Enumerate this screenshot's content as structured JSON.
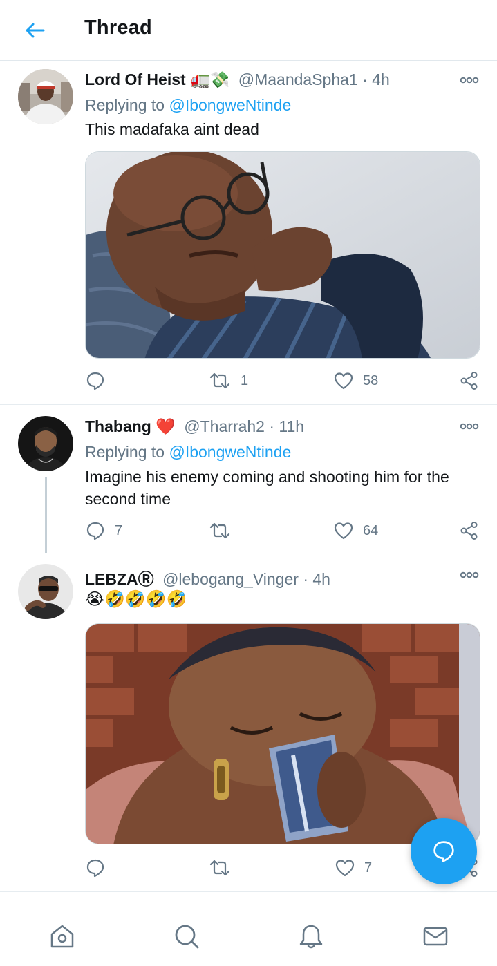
{
  "header": {
    "title": "Thread"
  },
  "tweets": [
    {
      "name": "Lord Of Heist",
      "name_emoji": "🚛💸",
      "handle": "@MaandaSpha1",
      "separator": "·",
      "time": "4h",
      "reply_prefix": "Replying to",
      "reply_to": "@IbongweNtinde",
      "text": "This madafaka aint dead",
      "reply_count": "",
      "retweet_count": "1",
      "like_count": "58"
    },
    {
      "name": "Thabang",
      "name_emoji": "❤️",
      "handle": "@Tharrah2",
      "separator": "·",
      "time": "11h",
      "reply_prefix": "Replying to",
      "reply_to": "@IbongweNtinde",
      "text": "Imagine his enemy coming and shooting him for the second time",
      "reply_count": "7",
      "retweet_count": "",
      "like_count": "64"
    },
    {
      "name": "LEBZA",
      "name_emoji": "Ⓡ",
      "handle": "@lebogang_Vinger",
      "separator": "·",
      "time": "4h",
      "text": "😭🤣🤣🤣🤣",
      "reply_count": "",
      "retweet_count": "",
      "like_count": "7"
    }
  ],
  "colors": {
    "accent": "#1da1f2",
    "text": "#14171a",
    "muted": "#657786",
    "like_red": "#e0245e"
  },
  "icons": {
    "back": "arrow-left-icon",
    "more": "more-dots-icon",
    "reply": "reply-bubble-icon",
    "retweet": "retweet-icon",
    "like": "heart-icon",
    "share": "share-icon",
    "compose": "compose-bubble-icon",
    "home": "home-icon",
    "search": "search-icon",
    "notifications": "bell-icon",
    "messages": "mail-icon"
  }
}
